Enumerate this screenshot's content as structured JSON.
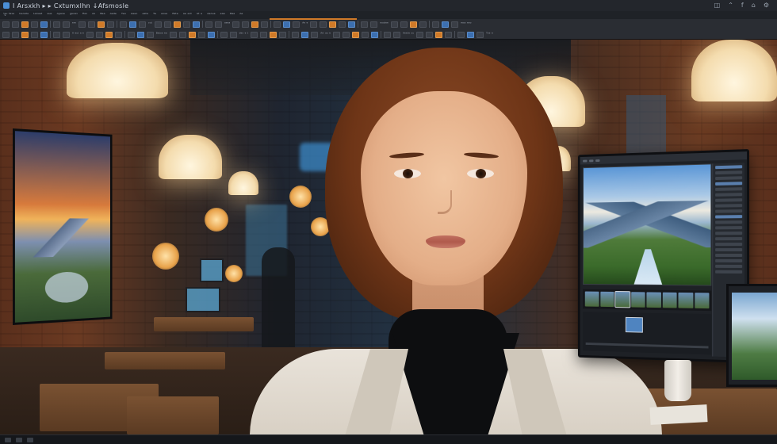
{
  "window": {
    "title": "Ⅰ Arsxkh ▸ ▸ Cxtumxlhn  ↓Afsmosle",
    "controls": [
      "◫",
      "⌃",
      "f",
      "⌂",
      "⚙"
    ]
  },
  "menubar": {
    "items": [
      "ˈtᵘ ᵗᵃˢᵉ",
      "ᵇᵉᵒᵃᵗᵉ",
      "ᴸᵃⁿᵘᵉᵗ",
      "ᵉᵘᵉ",
      "ᴬᵖᵉˢᵉ",
      "ᵍᵉᵒᵃˢ",
      "ᴿᵉˢ",
      "ᴬᵒ",
      "ᴮᵉᵃ",
      "ᴬᵉᵈᵉ",
      "ᵀᵉᵒ",
      "ᴬᵉᵉᵒ",
      "ᵉᵃᵗᵉ",
      "ᵀᵉ",
      "ᵉᵒᵘᵉ",
      "ᴱᵃᵗᵉ",
      "ᵃᵉ ᵉˢᵗ",
      "ᴬᵗ ᵉ",
      "ᴬᵉᵒᵘᵉ",
      "ᵉᵃᵉ",
      "ᴳᵃᵉ",
      "ᴬᵉ"
    ]
  },
  "toolbar": {
    "labels": [
      "ᵉʳᵉ",
      "ᵒᵘᵗ",
      "ᵃᵉᵉᵃ",
      "ᴬᵉ ᵉ",
      "ᵉᵒᵃᵗᵉᵉ",
      "ʳᵉᵃᵒ ᵉᵉᵒ",
      "ᴬ ᵉᵘᵗ ᵃ ᵉ",
      "ᴮᵃᵗᵒᵃ ᵉᵃ",
      "ᵈᵉᵒ ᵉ ᵗ",
      "ᴬʳᵗ ᵃᵘ ᵉ",
      "ᴬᵉᵉᵗᵉ ᵒᵘ",
      "ᵀᵒᵉ ᵉ",
      "ᵉᵉᵒ ᵘᵉ",
      "ᴼᵃᵗᵉ ᵉ ᵉ"
    ]
  },
  "accent_color": "#d07a28",
  "editor_panel": {
    "description_icons": [
      "image-thumbnail-icon",
      "histogram-icon",
      "layers-icon"
    ]
  }
}
